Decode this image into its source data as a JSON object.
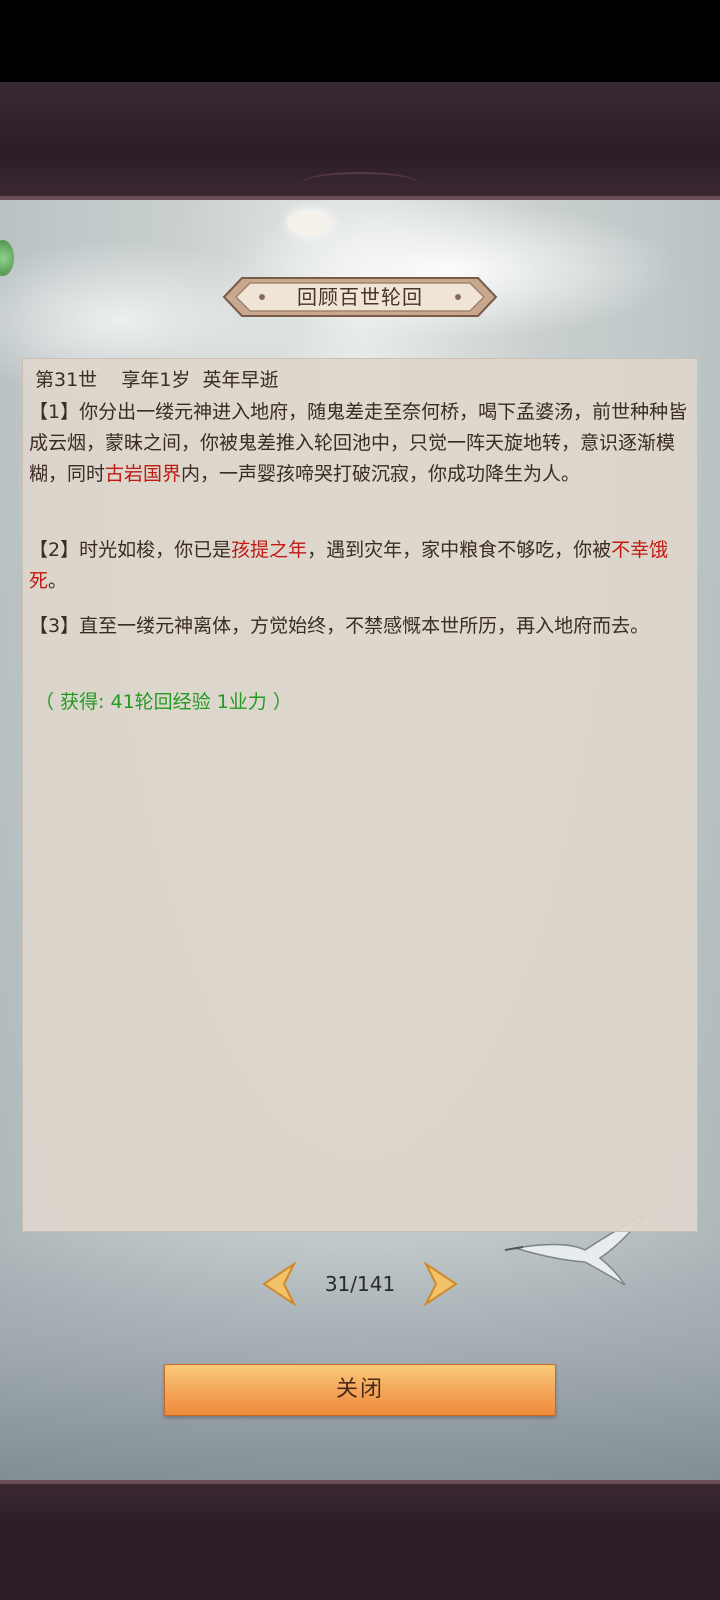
{
  "dialog": {
    "title": "回顾百世轮回"
  },
  "entry": {
    "header": "第31世    享年1岁  英年早逝",
    "paragraphs": [
      {
        "parts": [
          {
            "text": "【1】你分出一缕元神进入地府，随鬼差走至奈何桥，喝下孟婆汤，前世种种皆成云烟，蒙昧之间，你被鬼差推入轮回池中，只觉一阵天旋地转，意识逐渐模糊，同时"
          },
          {
            "text": "古岩国界",
            "highlight": true
          },
          {
            "text": "内，一声婴孩啼哭打破沉寂，你成功降生为人。"
          }
        ]
      },
      {
        "parts": [
          {
            "text": "【2】时光如梭，你已是"
          },
          {
            "text": "孩提之年",
            "highlight": true
          },
          {
            "text": "，遇到灾年，家中粮食不够吃，你被"
          },
          {
            "text": "不幸饿死",
            "highlight": true
          },
          {
            "text": "。"
          }
        ]
      },
      {
        "parts": [
          {
            "text": "【3】直至一缕元神离体，方觉始终，不禁感慨本世所历，再入地府而去。"
          }
        ]
      }
    ],
    "reward": "（ 获得: 41轮回经验 1业力 ）"
  },
  "pager": {
    "current": "31/141"
  },
  "close_button": {
    "label": "关闭"
  },
  "colors": {
    "highlight": "#c21a12",
    "reward": "#239a22",
    "button": "#f4a458"
  }
}
